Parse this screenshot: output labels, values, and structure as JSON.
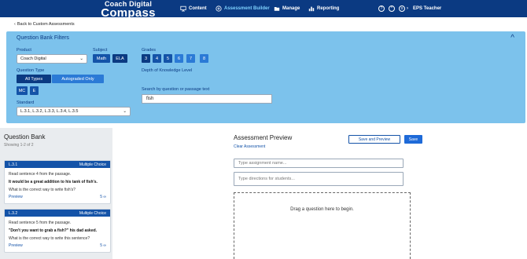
{
  "nav": {
    "logo_top": "Coach Digital",
    "logo_bottom": "Compass",
    "items": [
      {
        "label": "Content",
        "icon": "monitor-icon"
      },
      {
        "label": "Assessment Builder",
        "icon": "plus-circle-icon"
      },
      {
        "label": "Manage",
        "icon": "folder-icon"
      },
      {
        "label": "Reporting",
        "icon": "bar-chart-icon"
      }
    ],
    "user": "EPS Teacher"
  },
  "back_link": "Back to Custom Assessments",
  "filters": {
    "title": "Question Bank Filters",
    "product_label": "Product",
    "product_value": "Coach Digital",
    "subject_label": "Subject",
    "subjects": [
      "Math",
      "ELA"
    ],
    "grades_label": "Grades",
    "grades": [
      "3",
      "4",
      "5",
      "6",
      "7",
      "8"
    ],
    "question_type_label": "Question Type",
    "question_types": [
      "All Types",
      "Autograded Only"
    ],
    "type_codes": [
      "MC",
      "E"
    ],
    "dok_label": "Depth of Knowledge Level",
    "search_label": "Search by question or passage text",
    "search_value": "fish",
    "standard_label": "Standard",
    "standard_value": "L.3.1, L.3.2, L.3.3, L.3.4, L.3.5"
  },
  "bank": {
    "title": "Question Bank",
    "count": "Showing 1-2 of 2",
    "cards": [
      {
        "standard": "L.3.1",
        "type": "Multiple Choice",
        "line1": "Read sentence 4 from the passage.",
        "bold": "It would be a great addition to his tank of fish's.",
        "line2": "What is the correct way to write fish's?",
        "preview": "Preview",
        "points": "5"
      },
      {
        "standard": "L.3.2",
        "type": "Multiple Choice",
        "line1": "Read sentence 5 from the passage.",
        "bold": "\"Don't you want to grab a fish?\" his dad asked.",
        "line2": "What is the correct way to write this sentence?",
        "preview": "Preview",
        "points": "5"
      }
    ]
  },
  "preview": {
    "title": "Assessment Preview",
    "clear": "Clear Assessment",
    "save_preview": "Save and Preview",
    "save": "Save",
    "name_placeholder": "Type assignment name...",
    "directions_placeholder": "Type directions for students...",
    "drop_message": "Drag a question here to begin."
  }
}
